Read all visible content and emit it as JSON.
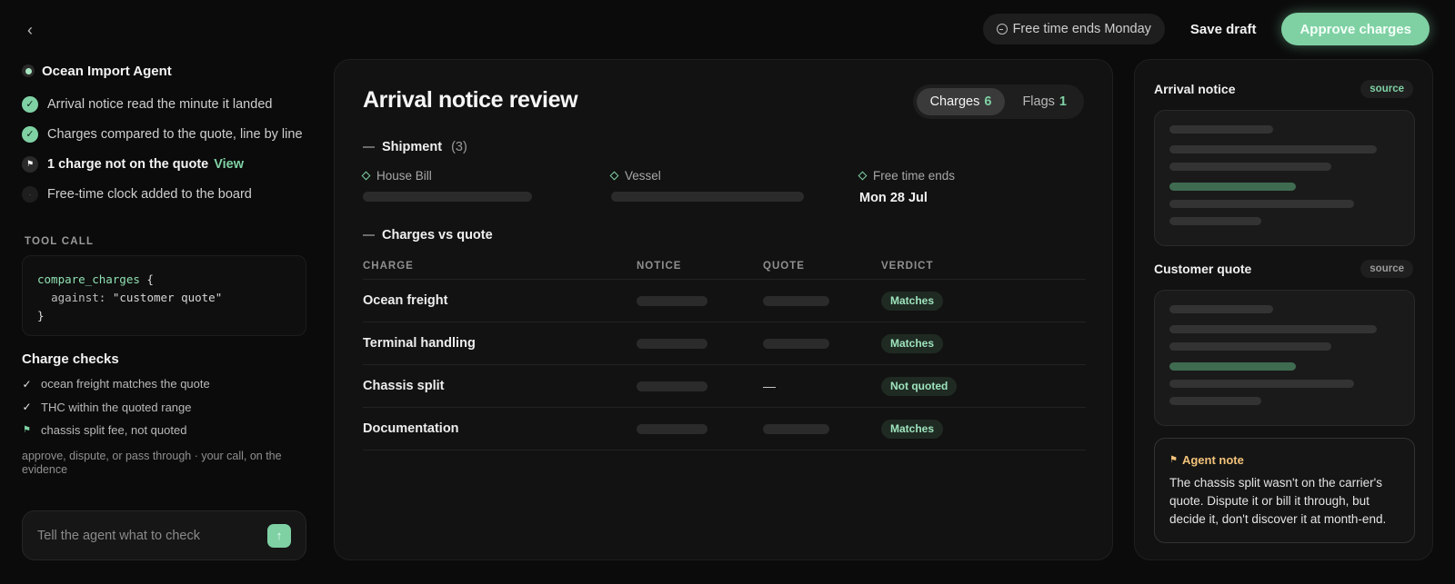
{
  "topbar": {
    "free_time_pill": "Free time ends Monday",
    "save_label": "Save draft",
    "approve_label": "Approve charges"
  },
  "agent": {
    "title": "Ocean Import Agent",
    "steps": [
      {
        "text": "Arrival notice read the minute it landed",
        "status": "done"
      },
      {
        "text": "Charges compared to the quote, line by line",
        "status": "done"
      },
      {
        "text": "1 charge not on the quote",
        "status": "flag",
        "link": "View"
      },
      {
        "text": "Free-time clock added to the board",
        "status": "pending"
      }
    ],
    "tool_call_label": "TOOL CALL",
    "tool_call": {
      "fn": "compare_charges",
      "open": "{",
      "arg_key": "against:",
      "arg_value": "\"customer quote\"",
      "close": "}"
    },
    "checks_title": "Charge checks",
    "checks": [
      {
        "text": "ocean freight matches the quote",
        "icon": "check"
      },
      {
        "text": "THC within the quoted range",
        "icon": "check"
      },
      {
        "text": "chassis split fee, not quoted",
        "icon": "flag"
      }
    ],
    "helper": "approve, dispute, or pass through · your call, on the evidence",
    "input_placeholder": "Tell the agent what to check"
  },
  "main": {
    "title": "Arrival notice review",
    "tabs": [
      {
        "label": "Charges",
        "count": "6",
        "active": true
      },
      {
        "label": "Flags",
        "count": "1",
        "active": false
      }
    ],
    "shipment": {
      "heading": "Shipment",
      "count": "(3)",
      "fields": [
        {
          "label": "House Bill",
          "value": null
        },
        {
          "label": "Vessel",
          "value": null
        },
        {
          "label": "Free time ends",
          "value": "Mon 28 Jul"
        }
      ]
    },
    "charges": {
      "heading": "Charges vs quote",
      "columns": [
        "CHARGE",
        "NOTICE",
        "QUOTE",
        "VERDICT"
      ],
      "rows": [
        {
          "charge": "Ocean freight",
          "quote": null,
          "verdict": "Matches"
        },
        {
          "charge": "Terminal handling",
          "quote": null,
          "verdict": "Matches"
        },
        {
          "charge": "Chassis split",
          "quote": "—",
          "verdict": "Not quoted"
        },
        {
          "charge": "Documentation",
          "quote": null,
          "verdict": "Matches"
        }
      ]
    }
  },
  "sidebar_right": {
    "docs": [
      {
        "title": "Arrival notice",
        "badge": "source",
        "badge_color": "#7fd1a4"
      },
      {
        "title": "Customer quote",
        "badge": "source",
        "badge_color": "#9a9a9a"
      }
    ],
    "note": {
      "title": "Agent note",
      "text": "The chassis split wasn't on the carrier's quote. Dispute it or bill it through, but decide it, don't discover it at month-end."
    }
  },
  "colors": {
    "accent": "#7fd1a4",
    "warning": "#f2c27a",
    "background": "#0b0b0b"
  }
}
